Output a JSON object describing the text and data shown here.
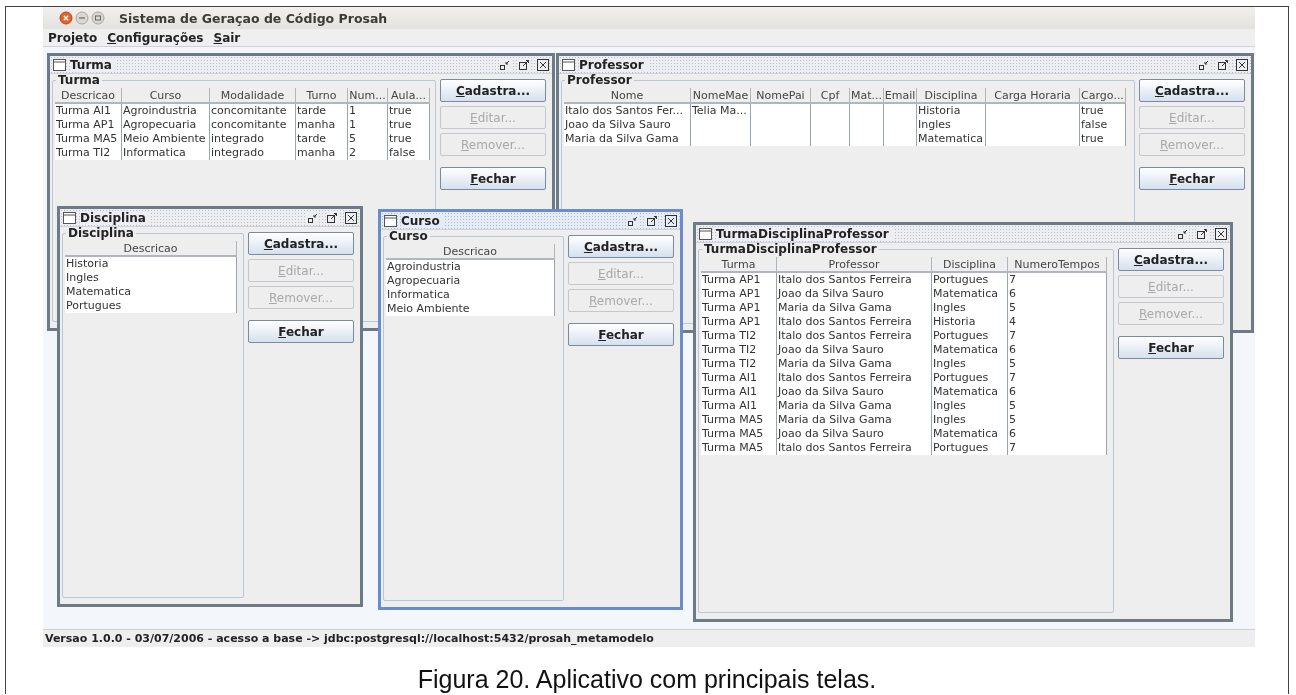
{
  "app": {
    "title": "Sistema de Geraçao de Código Prosah"
  },
  "menu": [
    {
      "label": "Projeto",
      "mnemonic": false
    },
    {
      "label": "Configurações",
      "mnemonic": true
    },
    {
      "label": "Sair",
      "mnemonic": true
    }
  ],
  "windows": [
    {
      "title": "Turma",
      "active": false,
      "group": "Turma",
      "columns": [
        "Descricao",
        "Curso",
        "Modalidade",
        "Turno",
        "Num...",
        "Aula..."
      ],
      "rows": [
        [
          "Turma AI1",
          "Agroindustria",
          "concomitante",
          "tarde",
          "1",
          "true"
        ],
        [
          "Turma AP1",
          "Agropecuaria",
          "concomitante",
          "manha",
          "1",
          "true"
        ],
        [
          "Turma MA5",
          "Meio Ambiente",
          "integrado",
          "tarde",
          "5",
          "true"
        ],
        [
          "Turma TI2",
          "Informatica",
          "integrado",
          "manha",
          "2",
          "false"
        ]
      ],
      "buttons": [
        {
          "label": "Cadastra...",
          "disabled": false
        },
        {
          "label": "Editar...",
          "disabled": true
        },
        {
          "label": "Remover...",
          "disabled": true
        },
        {
          "label": "Fechar",
          "disabled": false
        }
      ]
    },
    {
      "title": "Professor",
      "active": false,
      "group": "Professor",
      "columns": [
        "Nome",
        "NomeMae",
        "NomePai",
        "Cpf",
        "Mat...",
        "Email",
        "Disciplina",
        "Carga Horaria",
        "Cargo..."
      ],
      "rows": [
        [
          "Italo dos Santos Fer...",
          "Telia Ma...",
          null,
          null,
          null,
          null,
          "Historia",
          null,
          "true"
        ],
        [
          "Joao da Silva Sauro",
          null,
          null,
          null,
          null,
          null,
          "Ingles",
          null,
          "false"
        ],
        [
          "Maria da Silva Gama",
          null,
          null,
          null,
          null,
          null,
          "Matematica",
          null,
          "true"
        ]
      ],
      "buttons": [
        {
          "label": "Cadastra...",
          "disabled": false
        },
        {
          "label": "Editar...",
          "disabled": true
        },
        {
          "label": "Remover...",
          "disabled": true
        },
        {
          "label": "Fechar",
          "disabled": false
        }
      ]
    },
    {
      "title": "Disciplina",
      "active": false,
      "group": "Disciplina",
      "columns": [
        "Descricao"
      ],
      "rows": [
        [
          "Historia"
        ],
        [
          "Ingles"
        ],
        [
          "Matematica"
        ],
        [
          "Portugues"
        ]
      ],
      "buttons": [
        {
          "label": "Cadastra...",
          "disabled": false
        },
        {
          "label": "Editar...",
          "disabled": true
        },
        {
          "label": "Remover...",
          "disabled": true
        },
        {
          "label": "Fechar",
          "disabled": false
        }
      ]
    },
    {
      "title": "Curso",
      "active": true,
      "group": "Curso",
      "columns": [
        "Descricao"
      ],
      "rows": [
        [
          "Agroindustria"
        ],
        [
          "Agropecuaria"
        ],
        [
          "Informatica"
        ],
        [
          "Meio Ambiente"
        ]
      ],
      "buttons": [
        {
          "label": "Cadastra...",
          "disabled": false
        },
        {
          "label": "Editar...",
          "disabled": true
        },
        {
          "label": "Remover...",
          "disabled": true
        },
        {
          "label": "Fechar",
          "disabled": false
        }
      ]
    },
    {
      "title": "TurmaDisciplinaProfessor",
      "active": false,
      "group": "TurmaDisciplinaProfessor",
      "columns": [
        "Turma",
        "Professor",
        "Disciplina",
        "NumeroTempos"
      ],
      "rows": [
        [
          "Turma AP1",
          "Italo dos Santos Ferreira",
          "Portugues",
          "7"
        ],
        [
          "Turma AP1",
          "Joao da Silva Sauro",
          "Matematica",
          "6"
        ],
        [
          "Turma AP1",
          "Maria da Silva Gama",
          "Ingles",
          "5"
        ],
        [
          "Turma AP1",
          "Italo dos Santos Ferreira",
          "Historia",
          "4"
        ],
        [
          "Turma TI2",
          "Italo dos Santos Ferreira",
          "Portugues",
          "7"
        ],
        [
          "Turma TI2",
          "Joao da Silva Sauro",
          "Matematica",
          "6"
        ],
        [
          "Turma TI2",
          "Maria da Silva Gama",
          "Ingles",
          "5"
        ],
        [
          "Turma AI1",
          "Italo dos Santos Ferreira",
          "Portugues",
          "7"
        ],
        [
          "Turma AI1",
          "Joao da Silva Sauro",
          "Matematica",
          "6"
        ],
        [
          "Turma AI1",
          "Maria da Silva Gama",
          "Ingles",
          "5"
        ],
        [
          "Turma MA5",
          "Maria da Silva Gama",
          "Ingles",
          "5"
        ],
        [
          "Turma MA5",
          "Joao da Silva Sauro",
          "Matematica",
          "6"
        ],
        [
          "Turma MA5",
          "Italo dos Santos Ferreira",
          "Portugues",
          "7"
        ]
      ],
      "buttons": [
        {
          "label": "Cadastra...",
          "disabled": false
        },
        {
          "label": "Editar...",
          "disabled": true
        },
        {
          "label": "Remover...",
          "disabled": true
        },
        {
          "label": "Fechar",
          "disabled": false
        }
      ]
    }
  ],
  "status_bar": "Versao 1.0.0 - 03/07/2006 - acesso a base -> jdbc:postgresql://localhost:5432/prosah_metamodelo",
  "caption": "Figura 20. Aplicativo com principais telas."
}
